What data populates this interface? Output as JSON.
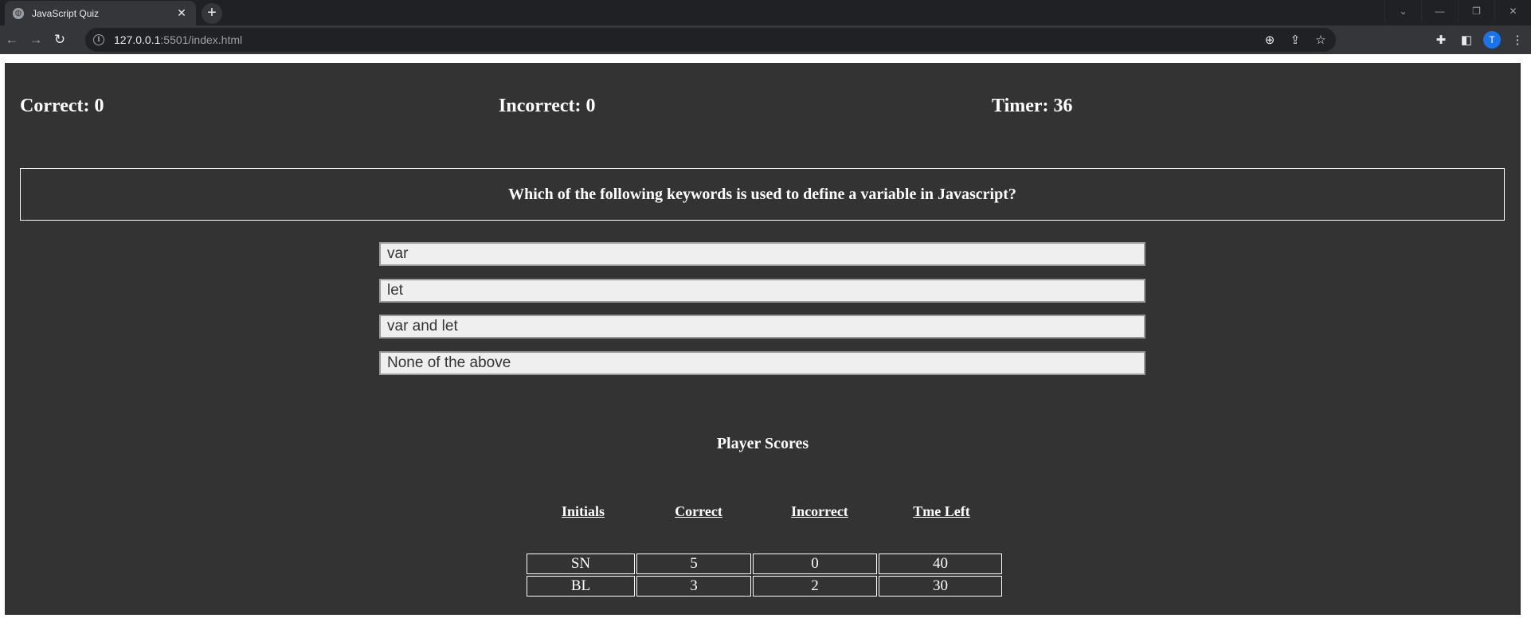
{
  "browser": {
    "tab_title": "JavaScript Quiz",
    "tab_close": "✕",
    "new_tab": "+",
    "url_host": "127.0.0.1",
    "url_rest": ":5501/index.html",
    "profile_initial": "T"
  },
  "stats": {
    "correct": "Correct: 0",
    "incorrect": "Incorrect: 0",
    "timer": "Timer: 36"
  },
  "question": "Which of the following keywords is used to define a variable in Javascript?",
  "answers": [
    "var",
    "let",
    "var and let",
    "None of the above"
  ],
  "scores": {
    "title": "Player Scores",
    "headers": [
      "Initials",
      "Correct",
      "Incorrect",
      "Tme Left"
    ],
    "rows": [
      [
        "SN",
        "5",
        "0",
        "40"
      ],
      [
        "BL",
        "3",
        "2",
        "30"
      ]
    ]
  },
  "colors": {
    "page_background": "#333333",
    "answer_background": "#efefef",
    "chrome_dark": "#202124",
    "chrome_toolbar": "#35363a"
  }
}
